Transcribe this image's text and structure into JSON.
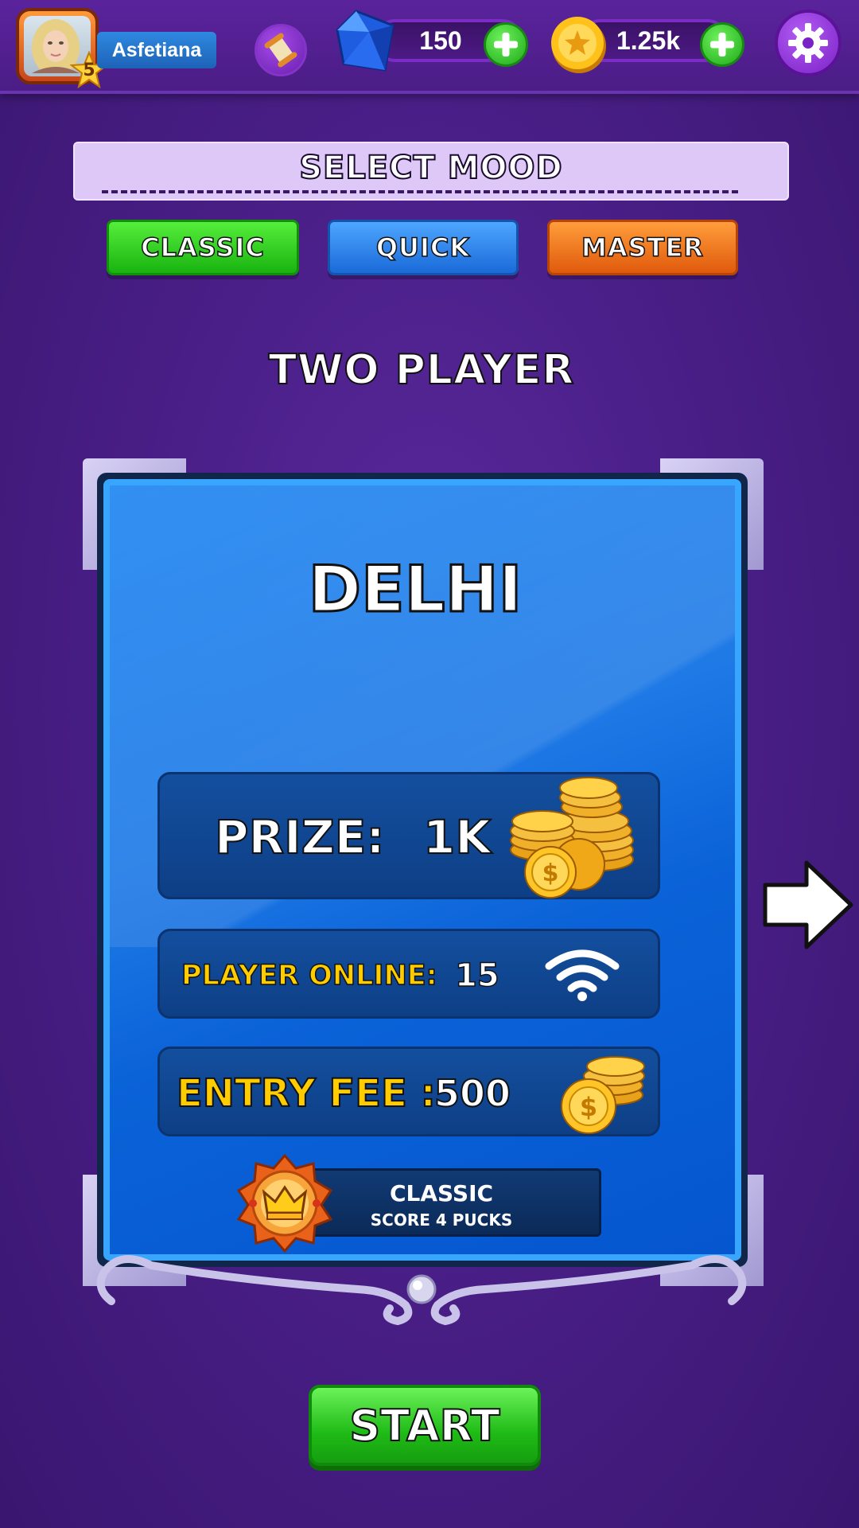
{
  "header": {
    "username": "Asfetiana",
    "level": "5",
    "gems": "150",
    "coins": "1.25k"
  },
  "mood": {
    "title": "SELECT MOOD",
    "modes": [
      "CLASSIC",
      "QUICK",
      "MASTER"
    ],
    "selected": "CLASSIC"
  },
  "mode_heading": "TWO PLAYER",
  "table": {
    "city": "DELHI",
    "prize_label": "PRIZE:",
    "prize_value": "1K",
    "online_label": "PLAYER ONLINE:",
    "online_value": "15",
    "fee_label": "ENTRY FEE :",
    "fee_value": "500",
    "rule_title": "CLASSIC",
    "rule_subtitle": "SCORE 4 PUCKS"
  },
  "start_label": "START",
  "colors": {
    "background": "#4a1f88",
    "card": "#1f7ae6",
    "accent_green": "#1fbb16",
    "accent_orange": "#e05a0c",
    "label_yellow": "#ffcc00"
  },
  "icons": [
    "avatar",
    "level-star-icon",
    "scroll-icon",
    "gem-icon",
    "coin-icon",
    "plus-icon",
    "gear-icon",
    "coin-stack-icon",
    "wifi-icon",
    "crown-badge-icon",
    "arrow-right-icon"
  ]
}
